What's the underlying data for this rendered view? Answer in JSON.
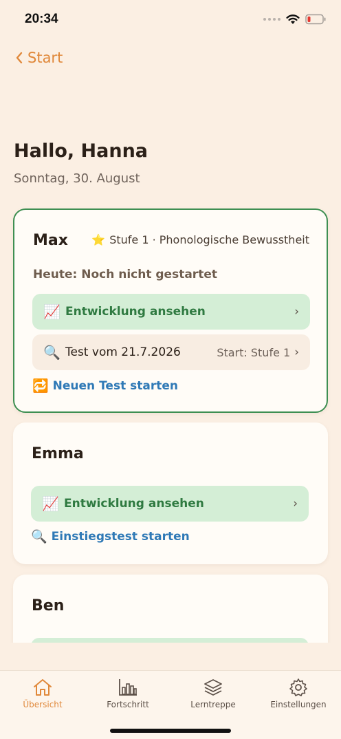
{
  "status_bar": {
    "time": "20:34",
    "icons": [
      "cellular-icon",
      "wifi-icon",
      "battery-low-icon"
    ]
  },
  "nav": {
    "back_label": "Start"
  },
  "header": {
    "greeting": "Hallo, Hanna",
    "date": "Sonntag, 30. August"
  },
  "children": [
    {
      "name": "Max",
      "level_emoji": "⭐",
      "level": "Stufe 1 · Phonologische Bewusstheit",
      "today_status": "Heute: Noch nicht gestartet",
      "progress_button": {
        "emoji": "📈",
        "label": "Entwicklung ansehen",
        "chevron": "›"
      },
      "test_row": {
        "emoji": "🔍",
        "label": "Test vom 21.7.2026",
        "right": "Start: Stufe 1",
        "chevron": "›"
      },
      "action": {
        "emoji": "🔁",
        "label": "Neuen Test starten"
      }
    },
    {
      "name": "Emma",
      "progress_button": {
        "emoji": "📈",
        "label": "Entwicklung ansehen",
        "chevron": "›"
      },
      "action": {
        "emoji": "🔍",
        "label": "Einstiegstest starten"
      }
    },
    {
      "name": "Ben"
    }
  ],
  "tabs": [
    {
      "label": "Übersicht",
      "icon": "home-icon",
      "active": true
    },
    {
      "label": "Fortschritt",
      "icon": "bar-chart-icon",
      "active": false
    },
    {
      "label": "Lerntreppe",
      "icon": "layers-icon",
      "active": false
    },
    {
      "label": "Einstellungen",
      "icon": "gear-icon",
      "active": false
    }
  ],
  "colors": {
    "accent": "#e0883a",
    "green": "#3e8f52",
    "link": "#2f79b6",
    "background": "#fbefe3"
  }
}
